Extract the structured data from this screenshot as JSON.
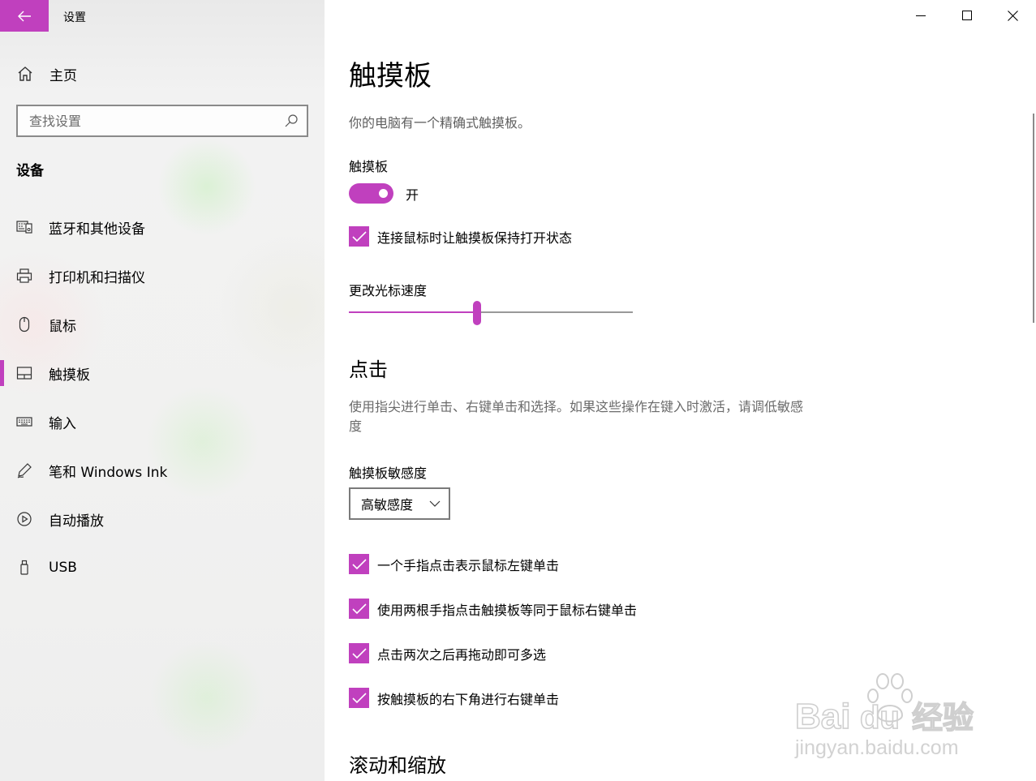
{
  "window": {
    "title": "设置"
  },
  "colors": {
    "accent": "#c040be"
  },
  "sidebar": {
    "home_label": "主页",
    "search_placeholder": "查找设置",
    "section_title": "设备",
    "items": [
      {
        "label": "蓝牙和其他设备",
        "icon": "bluetooth-devices-icon"
      },
      {
        "label": "打印机和扫描仪",
        "icon": "printer-icon"
      },
      {
        "label": "鼠标",
        "icon": "mouse-icon"
      },
      {
        "label": "触摸板",
        "icon": "touchpad-icon",
        "active": true
      },
      {
        "label": "输入",
        "icon": "keyboard-icon"
      },
      {
        "label": "笔和 Windows Ink",
        "icon": "pen-icon"
      },
      {
        "label": "自动播放",
        "icon": "autoplay-icon"
      },
      {
        "label": "USB",
        "icon": "usb-icon"
      }
    ]
  },
  "main": {
    "page_title": "触摸板",
    "description": "你的电脑有一个精确式触摸板。",
    "touchpad_label": "触摸板",
    "toggle_state_text": "开",
    "keep_on_checkbox": "连接鼠标时让触摸板保持打开状态",
    "cursor_speed_label": "更改光标速度",
    "cursor_speed_value": 0.45,
    "taps_heading": "点击",
    "taps_description": "使用指尖进行单击、右键单击和选择。如果这些操作在键入时激活，请调低敏感度",
    "sensitivity_label": "触摸板敏感度",
    "sensitivity_value": "高敏感度",
    "tap_options": [
      "一个手指点击表示鼠标左键单击",
      "使用两根手指点击触摸板等同于鼠标右键单击",
      "点击两次之后再拖动即可多选",
      "按触摸板的右下角进行右键单击"
    ],
    "scroll_heading": "滚动和缩放"
  },
  "watermark": {
    "brand": "Baidu经验",
    "url": "jingyan.baidu.com"
  }
}
